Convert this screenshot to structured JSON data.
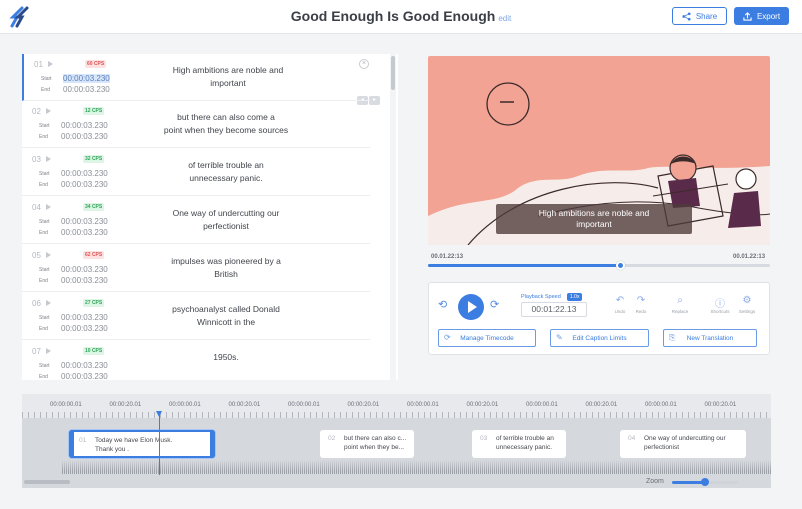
{
  "header": {
    "title": "Good Enough Is Good Enough",
    "edit_label": "edit",
    "share_label": "Share",
    "export_label": "Export"
  },
  "captions": [
    {
      "num": "01",
      "cps": "60 CPS",
      "cps_status": "red",
      "start_label": "Start",
      "end_label": "End",
      "start": "00:00:03.230",
      "end": "00:00:03.230",
      "text_line1": "High ambitions are noble and",
      "text_line2": "important",
      "active": true
    },
    {
      "num": "02",
      "cps": "12 CPS",
      "cps_status": "green",
      "start_label": "Start",
      "end_label": "End",
      "start": "00:00:03.230",
      "end": "00:00:03.230",
      "text_line1": "but there can also come a",
      "text_line2": "point when they become sources"
    },
    {
      "num": "03",
      "cps": "32 CPS",
      "cps_status": "green",
      "start_label": "Start",
      "end_label": "End",
      "start": "00:00:03.230",
      "end": "00:00:03.230",
      "text_line1": "of terrible trouble an",
      "text_line2": "unnecessary panic."
    },
    {
      "num": "04",
      "cps": "34 CPS",
      "cps_status": "green",
      "start_label": "Start",
      "end_label": "End",
      "start": "00:00:03.230",
      "end": "00:00:03.230",
      "text_line1": "One way of undercutting our",
      "text_line2": "perfectionist"
    },
    {
      "num": "05",
      "cps": "62 CPS",
      "cps_status": "red",
      "start_label": "Start",
      "end_label": "End",
      "start": "00:00:03.230",
      "end": "00:00:03.230",
      "text_line1": "impulses was pioneered by a",
      "text_line2": "British"
    },
    {
      "num": "06",
      "cps": "27 CPS",
      "cps_status": "green",
      "start_label": "Start",
      "end_label": "End",
      "start": "00:00:03.230",
      "end": "00:00:03.230",
      "text_line1": "psychoanalyst called Donald",
      "text_line2": "Winnicott in the"
    },
    {
      "num": "07",
      "cps": "10 CPS",
      "cps_status": "green",
      "start_label": "Start",
      "end_label": "End",
      "start": "00:00:03.230",
      "end": "00:00:03.230",
      "text_line1": "1950s.",
      "text_line2": ""
    }
  ],
  "video": {
    "subtitle_line1": "High ambitions are noble and",
    "subtitle_line2": "important",
    "time_current": "00.01.22:13",
    "time_total": "00.01.22:13",
    "progress": 0.56
  },
  "controls": {
    "speed_label": "Playback Speed",
    "speed_value": "1.0x",
    "time_value": "00:01:22.13",
    "tools": [
      {
        "icon": "undo-icon",
        "glyph": "↶",
        "label": "Undo"
      },
      {
        "icon": "redo-icon",
        "glyph": "↷",
        "label": "Redo"
      },
      {
        "icon": "replace-icon",
        "glyph": "⌕",
        "label": "Replace"
      },
      {
        "icon": "shortcuts-icon",
        "glyph": "ⓘ",
        "label": "Shortcuts"
      },
      {
        "icon": "settings-icon",
        "glyph": "⚙",
        "label": "Settings"
      }
    ],
    "manage_timecode": "Manage Timecode",
    "edit_caption_limits": "Edit Caption Limits",
    "new_translation": "New Translation"
  },
  "timeline": {
    "ruler_labels": [
      "00:00:00.01",
      "00:00:20.01",
      "00:00:00.01",
      "00:00:20.01",
      "00:00:00.01",
      "00:00:20.01",
      "00:00:00.01",
      "00:00:20.01",
      "00:00:00.01",
      "00:00:20.01",
      "00:00:00.01",
      "00:00:20.01"
    ],
    "clips": [
      {
        "num": "01",
        "line1": "Today we have Elon Musk.",
        "line2": "Thank you .",
        "active": true
      },
      {
        "num": "02",
        "line1": "but there can also c...",
        "line2": "point when they be..."
      },
      {
        "num": "03",
        "line1": "of terrible trouble an",
        "line2": "unnecessary panic."
      },
      {
        "num": "04",
        "line1": "One way of undercutting our",
        "line2": "perfectionist"
      }
    ],
    "zoom_label": "Zoom",
    "zoom_level": 0.5
  },
  "colors": {
    "accent": "#3b7de0",
    "video_bg": "#f2a394",
    "cps_red": "#e05555",
    "cps_green": "#34a55a"
  }
}
